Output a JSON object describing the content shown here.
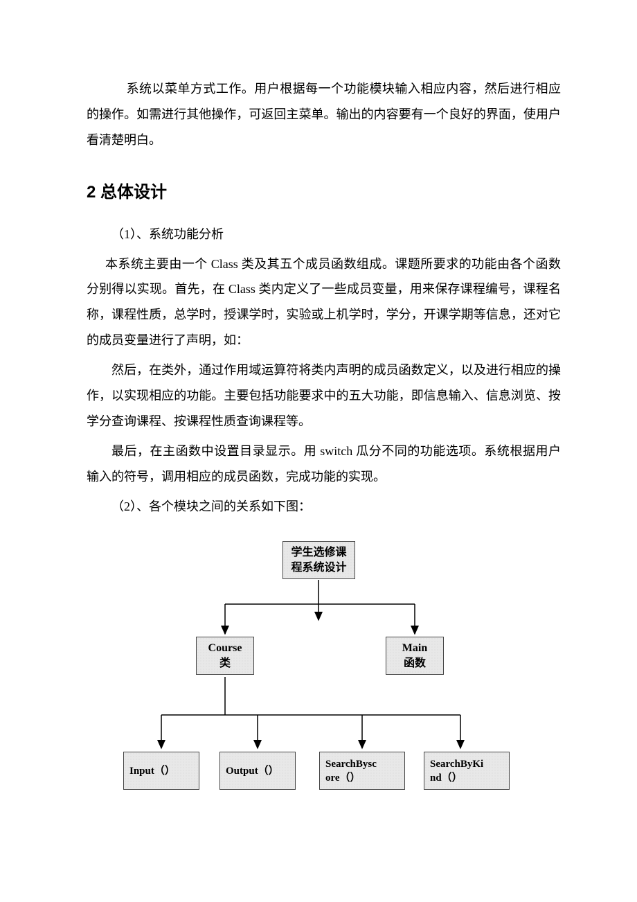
{
  "para1": "系统以菜单方式工作。用户根据每一个功能模块输入相应内容，然后进行相应的操作。如需进行其他操作，可返回主菜单。输出的内容要有一个良好的界面，使用户看清楚明白。",
  "section_heading": "2 总体设计",
  "sub1_title": "（1）、系统功能分析",
  "sub1_p1": "本系统主要由一个 Class 类及其五个成员函数组成。课题所要求的功能由各个函数分别得以实现。首先，在 Class 类内定义了一些成员变量，用来保存课程编号，课程名称，课程性质，总学时，授课学时，实验或上机学时，学分，开课学期等信息，还对它的成员变量进行了声明，如：",
  "sub1_p2": "然后，在类外，通过作用域运算符将类内声明的成员函数定义，以及进行相应的操作，以实现相应的功能。主要包括功能要求中的五大功能，即信息输入、信息浏览、按学分查询课程、按课程性质查询课程等。",
  "sub1_p3": "最后，在主函数中设置目录显示。用 switch 瓜分不同的功能选项。系统根据用户输入的符号，调用相应的成员函数，完成功能的实现。",
  "sub2_title": "（2）、各个模块之间的关系如下图：",
  "chart_data": {
    "type": "tree",
    "root": {
      "label": "学生选修课\n程系统设计",
      "children": [
        {
          "label": "Course\n类",
          "children": [
            {
              "label": "Input（）"
            },
            {
              "label": "Output（）"
            },
            {
              "label": "SearchBysc\nore（）"
            },
            {
              "label": "SearchByKi\nnd（）"
            }
          ]
        },
        {
          "label": "Main\n函数",
          "children": []
        }
      ]
    }
  }
}
